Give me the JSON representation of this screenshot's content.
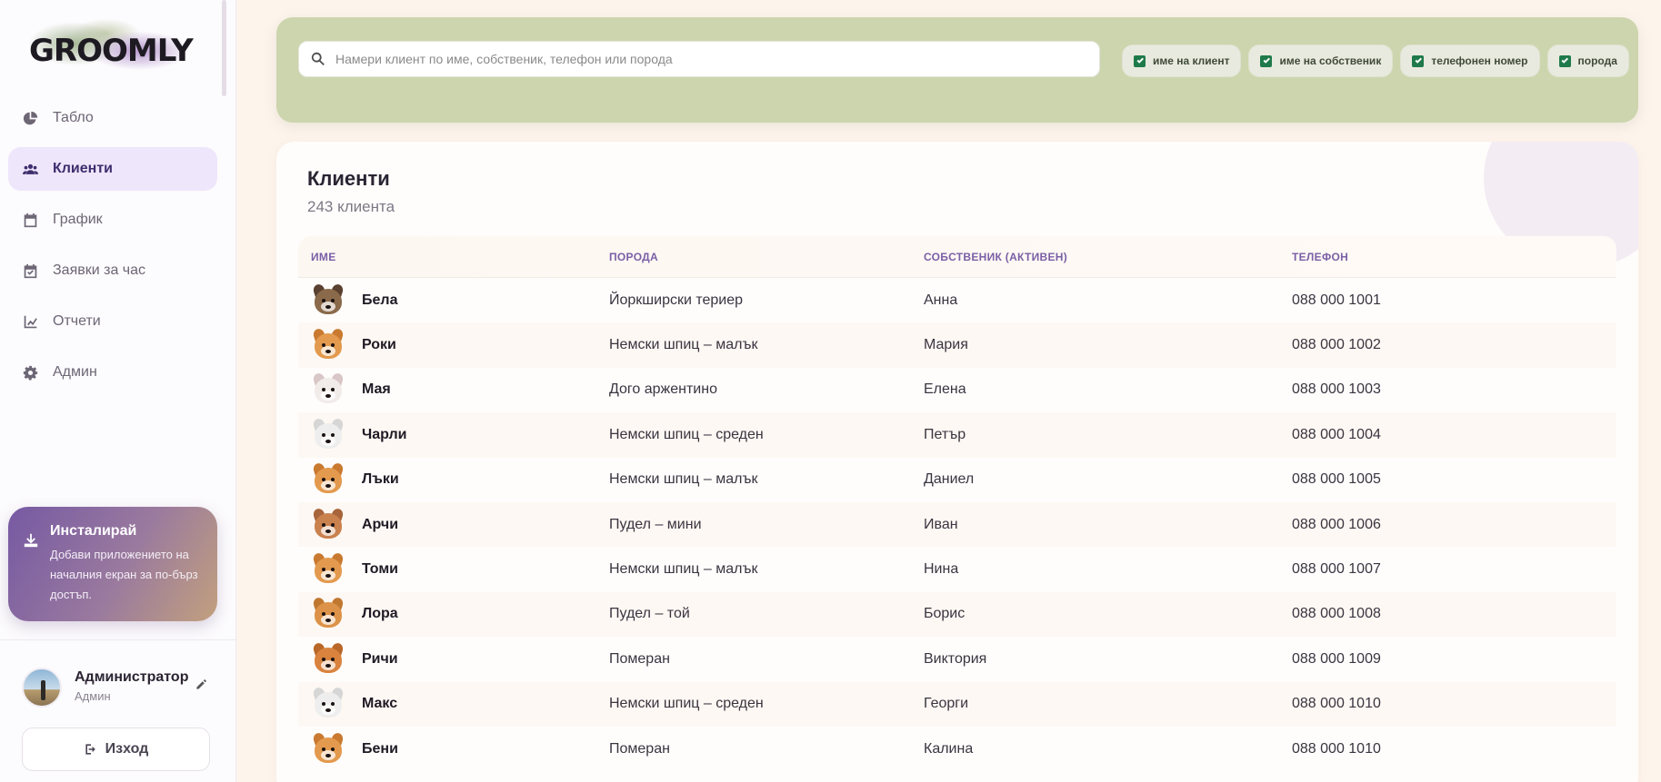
{
  "app": {
    "logo_text": "GROOMLY"
  },
  "sidebar": {
    "items": [
      {
        "label": "Табло",
        "icon": "pie-chart-icon",
        "active": false
      },
      {
        "label": "Клиенти",
        "icon": "users-icon",
        "active": true
      },
      {
        "label": "График",
        "icon": "calendar-icon",
        "active": false
      },
      {
        "label": "Заявки за час",
        "icon": "calendar-check-icon",
        "active": false
      },
      {
        "label": "Отчети",
        "icon": "line-chart-icon",
        "active": false
      },
      {
        "label": "Админ",
        "icon": "gear-icon",
        "active": false
      }
    ],
    "install": {
      "title": "Инсталирай",
      "text": "Добави приложението на началния екран за по-бърз достъп.",
      "icon": "download-icon"
    },
    "user": {
      "name": "Администратор",
      "role": "Админ",
      "edit_icon": "pencil-icon"
    },
    "logout_label": "Изход"
  },
  "search": {
    "placeholder": "Намери клиент по име, собственик, телефон или порода",
    "value": "",
    "filters": [
      {
        "label": "име на клиент",
        "checked": true
      },
      {
        "label": "име на собственик",
        "checked": true
      },
      {
        "label": "телефонен номер",
        "checked": true
      },
      {
        "label": "порода",
        "checked": true
      }
    ]
  },
  "clients": {
    "title": "Клиенти",
    "count_text": "243 клиента",
    "columns": [
      "ИМЕ",
      "ПОРОДА",
      "СОБСТВЕНИК (АКТИВЕН)",
      "ТЕЛЕФОН"
    ],
    "rows": [
      {
        "name": "Бела",
        "breed": "Йоркширски териер",
        "owner": "Анна",
        "phone": "088 000 1001",
        "avatar": "yorkshire-terrier",
        "color": "#8a6a4a",
        "ear": "#5a4030"
      },
      {
        "name": "Роки",
        "breed": "Немски шпиц – малък",
        "owner": "Мария",
        "phone": "088 000 1002",
        "avatar": "spitz-orange",
        "color": "#e39a4e",
        "ear": "#c97a30"
      },
      {
        "name": "Мая",
        "breed": "Дого аржентино",
        "owner": "Елена",
        "phone": "088 000 1003",
        "avatar": "dogo-argentino",
        "color": "#f1ecea",
        "ear": "#d9c6c6"
      },
      {
        "name": "Чарли",
        "breed": "Немски шпиц – среден",
        "owner": "Петър",
        "phone": "088 000 1004",
        "avatar": "spitz-white",
        "color": "#eeeeee",
        "ear": "#d6d6d6"
      },
      {
        "name": "Лъки",
        "breed": "Немски шпиц – малък",
        "owner": "Даниел",
        "phone": "088 000 1005",
        "avatar": "spitz-orange",
        "color": "#e39a4e",
        "ear": "#c97a30"
      },
      {
        "name": "Арчи",
        "breed": "Пудел – мини",
        "owner": "Иван",
        "phone": "088 000 1006",
        "avatar": "poodle-brown",
        "color": "#c9814e",
        "ear": "#a8643a"
      },
      {
        "name": "Томи",
        "breed": "Немски шпиц – малък",
        "owner": "Нина",
        "phone": "088 000 1007",
        "avatar": "spitz-orange",
        "color": "#e39a4e",
        "ear": "#c97a30"
      },
      {
        "name": "Лора",
        "breed": "Пудел – той",
        "owner": "Борис",
        "phone": "088 000 1008",
        "avatar": "poodle-apricot",
        "color": "#dc9248",
        "ear": "#c07830"
      },
      {
        "name": "Ричи",
        "breed": "Померан",
        "owner": "Виктория",
        "phone": "088 000 1009",
        "avatar": "pomeranian",
        "color": "#d9833e",
        "ear": "#b86728"
      },
      {
        "name": "Макс",
        "breed": "Немски шпиц – среден",
        "owner": "Георги",
        "phone": "088 000 1010",
        "avatar": "spitz-white",
        "color": "#eeeeee",
        "ear": "#d6d6d6"
      },
      {
        "name": "Бени",
        "breed": "Померан",
        "owner": "Калина",
        "phone": "088 000 1010",
        "avatar": "pomeranian",
        "color": "#e39a4e",
        "ear": "#c97a30"
      }
    ]
  }
}
